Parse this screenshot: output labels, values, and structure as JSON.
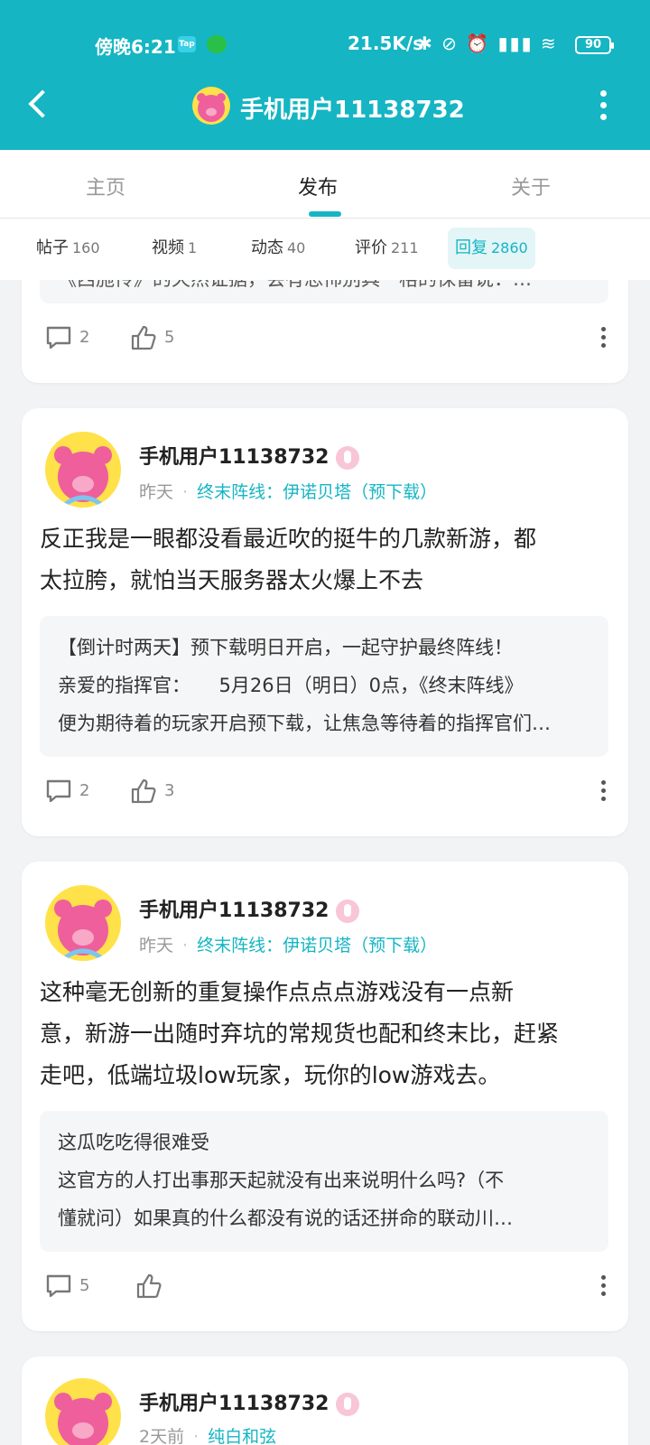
{
  "status_bar": {
    "time": "傍晚6:21",
    "net_speed": "21.5K/s",
    "signal_icons": "✱ ⊘ ⏰ ▮▮▮ ≋",
    "battery": "90"
  },
  "header": {
    "title": "手机用户11138732",
    "accent_color": "#15b5c3"
  },
  "tabs": {
    "home": "主页",
    "publish": "发布",
    "about": "关于"
  },
  "subtabs": [
    {
      "label": "帖子",
      "count": "160"
    },
    {
      "label": "视频",
      "count": "1"
    },
    {
      "label": "动态",
      "count": "40"
    },
    {
      "label": "评价",
      "count": "211"
    },
    {
      "label": "回复",
      "count": "2860"
    }
  ],
  "cards": [
    {
      "quote_line": "《西施传》的天然证据，会有恐怖别具一格的保留说：…",
      "comments": "2",
      "likes": "5"
    },
    {
      "user": "手机用户11138732",
      "time": "昨天",
      "game": "终末阵线：伊诺贝塔（预下载）",
      "content_lines": [
        "反正我是一眼都没看最近吹的挺牛的几款新游，都",
        "太拉胯，就怕当天服务器太火爆上不去"
      ],
      "quote": [
        "【倒计时两天】预下载明日开启，一起守护最终阵线！",
        "亲爱的指挥官：　　5月26日（明日）0点，《终末阵线》",
        "便为期待着的玩家开启预下载，让焦急等待着的指挥官们…"
      ],
      "comments": "2",
      "likes": "3"
    },
    {
      "user": "手机用户11138732",
      "time": "昨天",
      "game": "终末阵线：伊诺贝塔（预下载）",
      "content_lines": [
        "这种毫无创新的重复操作点点点游戏没有一点新",
        "意，新游一出随时弃坑的常规货也配和终末比，赶紧",
        "走吧，低端垃圾low玩家，玩你的low游戏去。"
      ],
      "quote": [
        "这瓜吃吃得很难受",
        "这官方的人打出事那天起就没有出来说明什么吗?（不",
        "懂就问）如果真的什么都没有说的话还拼命的联动川…"
      ],
      "comments": "5",
      "likes": ""
    },
    {
      "user": "手机用户11138732",
      "time": "2天前",
      "game": "纯白和弦"
    }
  ]
}
